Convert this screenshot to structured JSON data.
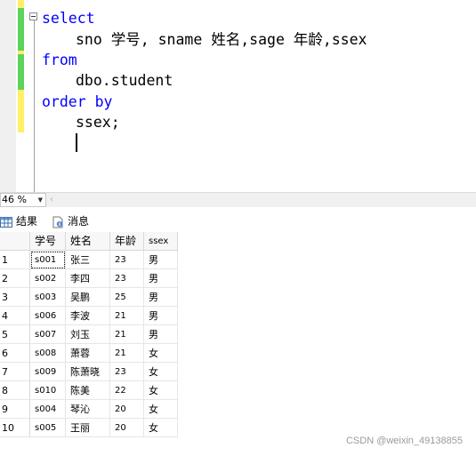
{
  "editor": {
    "lines": [
      {
        "kw": "select",
        "text": ""
      },
      {
        "kw": "",
        "text": "sno 学号, sname 姓名,sage 年龄,ssex"
      },
      {
        "kw": "from",
        "text": ""
      },
      {
        "kw": "",
        "text": "dbo.student"
      },
      {
        "kw": "order by",
        "text": ""
      },
      {
        "kw": "",
        "text": "ssex;"
      }
    ],
    "colors": {
      "keyword": "#0000ff",
      "saved_bar": "#5cd35c",
      "unsaved_bar": "#fff066"
    }
  },
  "zoom": {
    "value": "46 %"
  },
  "tabs": [
    {
      "label": "结果",
      "icon": "grid-icon"
    },
    {
      "label": "消息",
      "icon": "message-icon"
    }
  ],
  "grid": {
    "columns": [
      "学号",
      "姓名",
      "年龄",
      "ssex"
    ],
    "rows": [
      {
        "n": "1",
        "sno": "s001",
        "sname": "张三",
        "sage": "23",
        "ssex": "男"
      },
      {
        "n": "2",
        "sno": "s002",
        "sname": "李四",
        "sage": "23",
        "ssex": "男"
      },
      {
        "n": "3",
        "sno": "s003",
        "sname": "吴鹏",
        "sage": "25",
        "ssex": "男"
      },
      {
        "n": "4",
        "sno": "s006",
        "sname": "李波",
        "sage": "21",
        "ssex": "男"
      },
      {
        "n": "5",
        "sno": "s007",
        "sname": "刘玉",
        "sage": "21",
        "ssex": "男"
      },
      {
        "n": "6",
        "sno": "s008",
        "sname": "萧蓉",
        "sage": "21",
        "ssex": "女"
      },
      {
        "n": "7",
        "sno": "s009",
        "sname": "陈萧晓",
        "sage": "23",
        "ssex": "女"
      },
      {
        "n": "8",
        "sno": "s010",
        "sname": "陈美",
        "sage": "22",
        "ssex": "女"
      },
      {
        "n": "9",
        "sno": "s004",
        "sname": "琴沁",
        "sage": "20",
        "ssex": "女"
      },
      {
        "n": "10",
        "sno": "s005",
        "sname": "王丽",
        "sage": "20",
        "ssex": "女"
      }
    ]
  },
  "watermark": "CSDN @weixin_49138855"
}
